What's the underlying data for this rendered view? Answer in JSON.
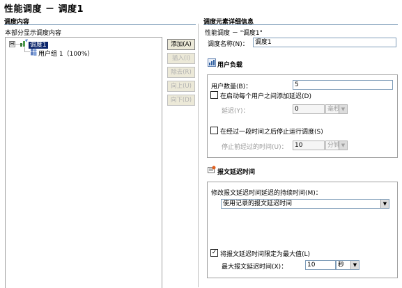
{
  "window": {
    "title": "性能调度 － 调度1"
  },
  "left": {
    "header": "调度内容",
    "subtitle": "本部分显示调度内容",
    "tree": {
      "root_label": "调度1",
      "child_label": "用户组 1（100%）",
      "expander": "⊟"
    },
    "buttons": {
      "add": "添加(A)",
      "insert": "插入(I)",
      "remove": "除去(R)",
      "up": "向上(U)",
      "down": "向下(D)"
    }
  },
  "right": {
    "header": "调度元素详细信息",
    "breadcrumb": "性能调度 － \"调度1\"",
    "schedule_name_label": "调度名称(N)：",
    "schedule_name_value": "调度1",
    "user_load": {
      "title": "用户负载",
      "user_count_label": "用户数量(B)：",
      "user_count_value": "5",
      "add_delay_label": "在启动每个用户之间添加延迟(D)",
      "add_delay_checked": false,
      "delay_label": "延迟(Y)：",
      "delay_value": "0",
      "delay_unit": "毫秒",
      "stop_after_label": "在经过一段时间之后停止运行调度(S)",
      "stop_after_checked": false,
      "stop_time_label": "停止前经过的时间(U)：",
      "stop_time_value": "10",
      "stop_time_unit": "分钟"
    },
    "think_time": {
      "title": "报文延迟时间",
      "modify_label": "修改报文延迟时间延迟的持续时间(M)：",
      "modify_value": "使用记录的报文延迟时间",
      "limit_label": "将报文延迟时间限定为最大值(L)",
      "limit_checked": true,
      "max_label": "最大报文延迟时间(X)：",
      "max_value": "10",
      "max_unit": "秒"
    }
  }
}
